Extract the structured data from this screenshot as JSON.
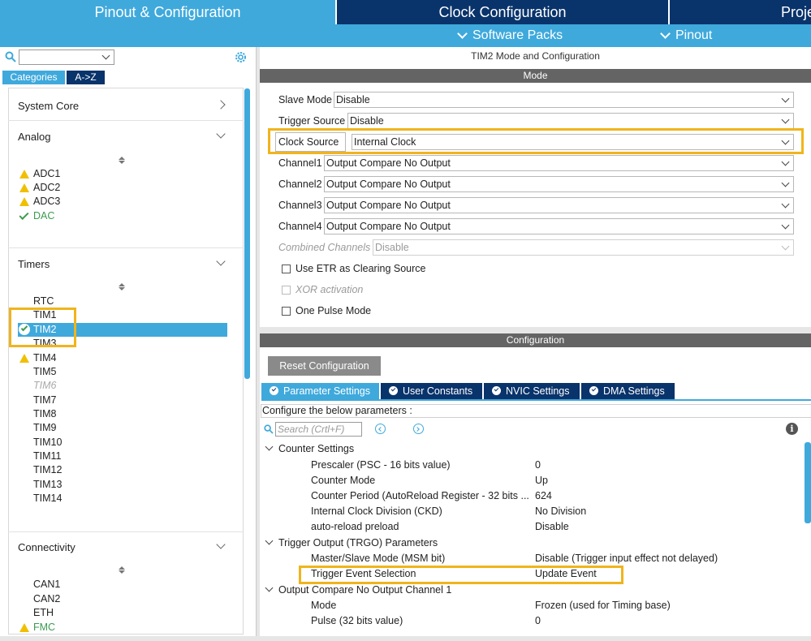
{
  "tabs": [
    {
      "label": "Pinout & Configuration",
      "active": true
    },
    {
      "label": "Clock Configuration",
      "active": false
    },
    {
      "label": "Proje",
      "active": false
    }
  ],
  "subbar": {
    "software_packs": "Software Packs",
    "pinout": "Pinout"
  },
  "left": {
    "search_value": "",
    "categories_btn": "Categories",
    "az_btn": "A->Z",
    "groups": {
      "system_core": "System Core",
      "analog": "Analog",
      "timers": "Timers",
      "connectivity": "Connectivity"
    },
    "analog_items": [
      {
        "label": "ADC1",
        "status": "warning"
      },
      {
        "label": "ADC2",
        "status": "warning"
      },
      {
        "label": "ADC3",
        "status": "warning"
      },
      {
        "label": "DAC",
        "status": "ok"
      }
    ],
    "timer_items": [
      "RTC",
      "TIM1",
      "TIM2",
      "TIM3",
      "TIM4",
      "TIM5",
      "TIM6",
      "TIM7",
      "TIM8",
      "TIM9",
      "TIM10",
      "TIM11",
      "TIM12",
      "TIM13",
      "TIM14"
    ],
    "connectivity_items": [
      "CAN1",
      "CAN2",
      "ETH",
      "FMC"
    ]
  },
  "right": {
    "title": "TIM2 Mode and Configuration",
    "mode_header": "Mode",
    "mode_fields": {
      "slave_mode": {
        "label": "Slave Mode",
        "value": "Disable"
      },
      "trigger_source": {
        "label": "Trigger Source",
        "value": "Disable"
      },
      "clock_source": {
        "label": "Clock Source",
        "value": "Internal Clock"
      },
      "channel1": {
        "label": "Channel1",
        "value": "Output Compare No Output"
      },
      "channel2": {
        "label": "Channel2",
        "value": "Output Compare No Output"
      },
      "channel3": {
        "label": "Channel3",
        "value": "Output Compare No Output"
      },
      "channel4": {
        "label": "Channel4",
        "value": "Output Compare No Output"
      },
      "combined": {
        "label": "Combined Channels",
        "value": "Disable"
      }
    },
    "checkboxes": {
      "etr": "Use ETR as Clearing Source",
      "xor": "XOR activation",
      "one_pulse": "One Pulse Mode"
    },
    "config_header": "Configuration",
    "reset_btn": "Reset Configuration",
    "param_tabs": [
      "Parameter Settings",
      "User Constants",
      "NVIC Settings",
      "DMA Settings"
    ],
    "configure_text": "Configure the below parameters :",
    "search_placeholder": "Search (Crtl+F)",
    "sections": {
      "counter": "Counter Settings",
      "trgo": "Trigger Output (TRGO) Parameters",
      "oc": "Output Compare No Output Channel 1"
    },
    "counter_params": [
      {
        "name": "Prescaler (PSC - 16 bits value)",
        "value": "0"
      },
      {
        "name": "Counter Mode",
        "value": "Up"
      },
      {
        "name": "Counter Period (AutoReload Register - 32 bits ...",
        "value": "624"
      },
      {
        "name": "Internal Clock Division (CKD)",
        "value": "No Division"
      },
      {
        "name": "auto-reload preload",
        "value": "Disable"
      }
    ],
    "trgo_params": [
      {
        "name": "Master/Slave Mode (MSM bit)",
        "value": "Disable (Trigger input effect not delayed)"
      },
      {
        "name": "Trigger Event Selection",
        "value": "Update Event"
      }
    ],
    "oc_params": [
      {
        "name": "Mode",
        "value": "Frozen (used for Timing base)"
      },
      {
        "name": "Pulse (32 bits value)",
        "value": "0"
      }
    ]
  },
  "colors": {
    "tab_active": "#3fa9dc",
    "tab_dark": "#09336b",
    "highlight": "#f0b41c",
    "warning": "#f0c000",
    "ok": "#3c9b4f"
  }
}
